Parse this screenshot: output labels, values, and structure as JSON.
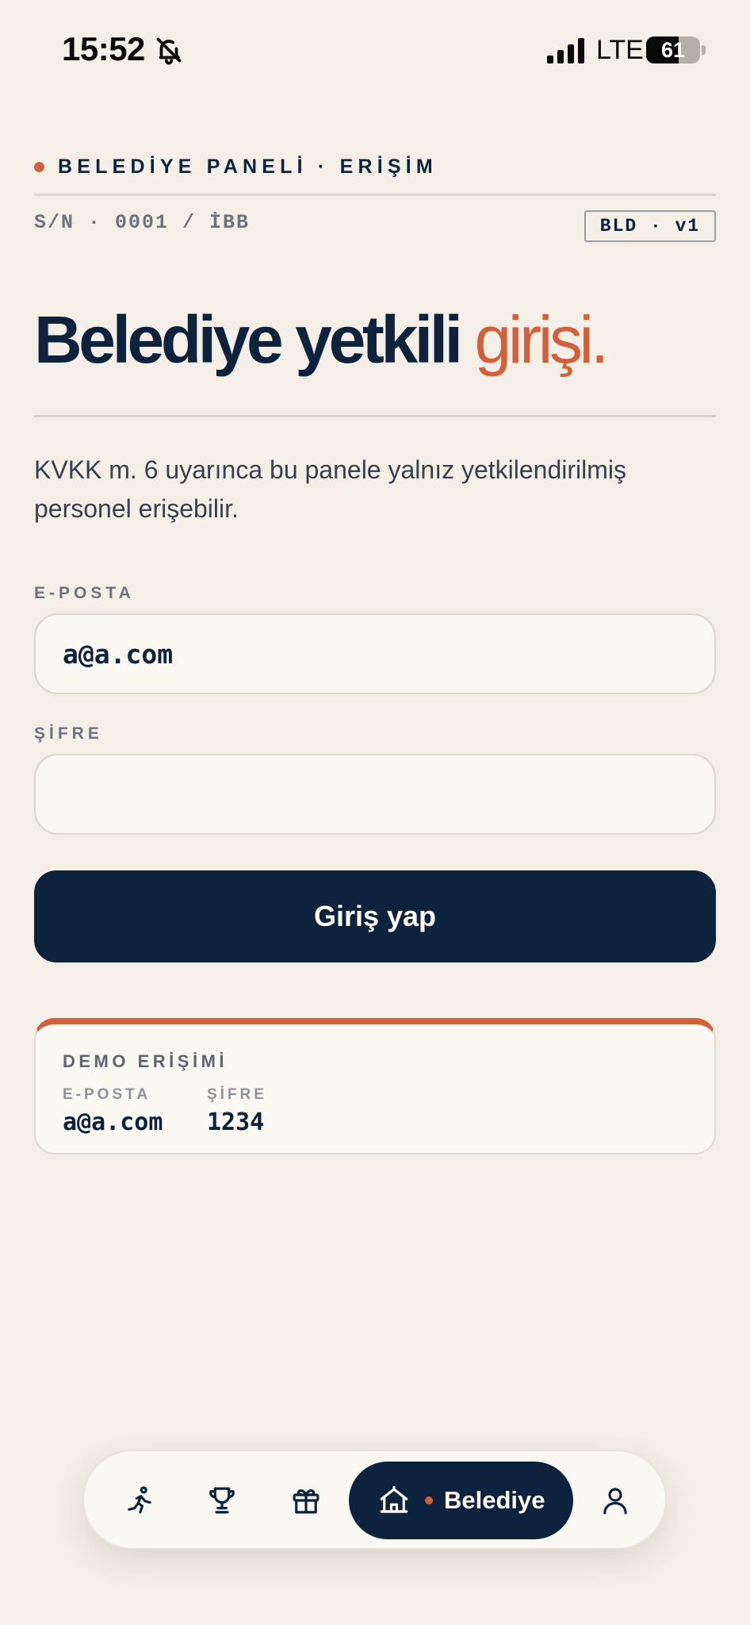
{
  "status_bar": {
    "time": "15:52",
    "network": "LTE",
    "battery": "61",
    "battery_level": 0.61,
    "icons": [
      "bell-muted-icon",
      "signal-icon",
      "battery-icon"
    ]
  },
  "header": {
    "eyebrow": "BELEDİYE PANELİ · ERİŞİM",
    "serial": "S/N · 0001 / İBB",
    "version_badge": "BLD · v1"
  },
  "title": {
    "main": "Belediye yetkili",
    "accent": "girişi."
  },
  "notice": "KVKK m. 6 uyarınca bu panele yalnız yetkilendirilmiş personel erişebilir.",
  "form": {
    "email_label": "E-POSTA",
    "email_value": "a@a.com",
    "password_label": "ŞİFRE",
    "password_value": "",
    "submit_label": "Giriş yap"
  },
  "demo_card": {
    "title": "DEMO ERİŞİMİ",
    "email_key": "E-POSTA",
    "email_value": "a@a.com",
    "password_key": "ŞİFRE",
    "password_value": "1234"
  },
  "bottom_nav": {
    "items": [
      {
        "icon": "runner-icon"
      },
      {
        "icon": "trophy-icon"
      },
      {
        "icon": "gift-icon"
      },
      {
        "icon": "municipality-icon",
        "label": "Belediye",
        "active": true
      },
      {
        "icon": "profile-icon"
      }
    ]
  },
  "colors": {
    "background": "#f4f0e8",
    "navy": "#0d223d",
    "accent": "#d2603a",
    "muted": "#6b7280",
    "card": "#faf8f3"
  }
}
